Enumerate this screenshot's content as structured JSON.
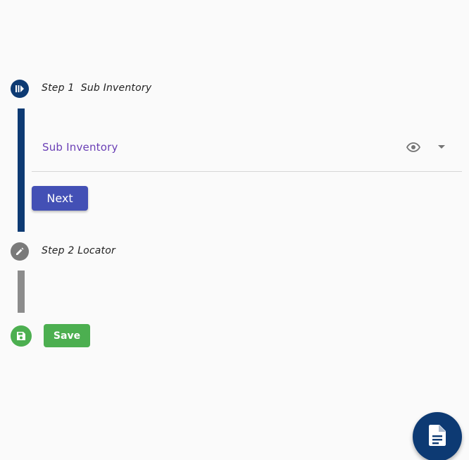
{
  "stepper": {
    "step1": {
      "title": "Step 1  Sub Inventory",
      "icon": "stepper-active-icon",
      "color": "#0d3a73"
    },
    "field": {
      "label": "Sub Inventory",
      "label_color": "#6a3fb5",
      "icons": [
        "eye-icon",
        "dropdown-caret-icon"
      ]
    },
    "next_label": "Next",
    "next_color": "#4350b5",
    "step2": {
      "title": "Step 2 Locator",
      "icon": "edit-icon",
      "color": "#7a7a7a"
    },
    "save": {
      "label": "Save",
      "icon": "save-icon",
      "color": "#4caf50"
    }
  },
  "fab": {
    "icon": "document-icon",
    "color": "#0d3a73"
  }
}
